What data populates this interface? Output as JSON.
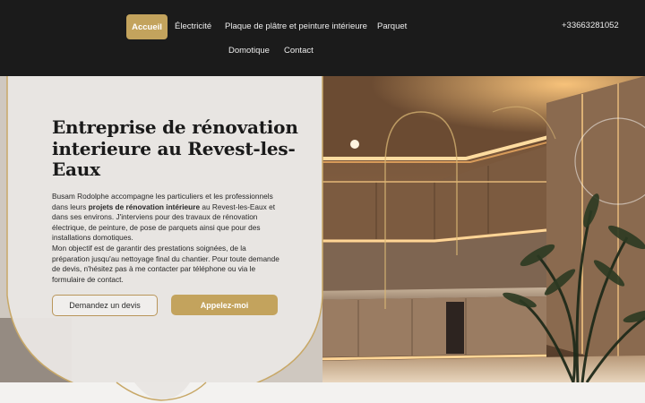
{
  "nav": {
    "items": [
      {
        "label": "Accueil",
        "active": true
      },
      {
        "label": "Électricité"
      },
      {
        "label": "Plaque de plâtre et peinture intérieure"
      },
      {
        "label": "Parquet"
      },
      {
        "label": "Domotique"
      },
      {
        "label": "Contact"
      }
    ],
    "phone": "+33663281052"
  },
  "hero": {
    "title": "Entreprise de rénovation interieure au Revest-les-Eaux",
    "paragraph": {
      "intro": "Busam Rodolphe accompagne les particuliers et les professionnels dans leurs ",
      "highlight": "projets de rénovation intérieure",
      "rest": " au Revest-les-Eaux et dans ses environs. J'interviens pour des travaux de rénovation électrique, de peinture, de pose de parquets ainsi que pour des installations domotiques.",
      "second": "Mon objectif est de garantir des prestations soignées, de la préparation jusqu'au nettoyage final du chantier. Pour toute demande de devis, n'hésitez pas à me contacter par téléphone ou via le formulaire de contact."
    },
    "buttons": {
      "quote": "Demandez un devis",
      "call": "Appelez-moi"
    }
  },
  "colors": {
    "header_bg": "#1b1b1b",
    "accent_gold": "#c3a35d",
    "panel_bg": "#eae7e4"
  }
}
